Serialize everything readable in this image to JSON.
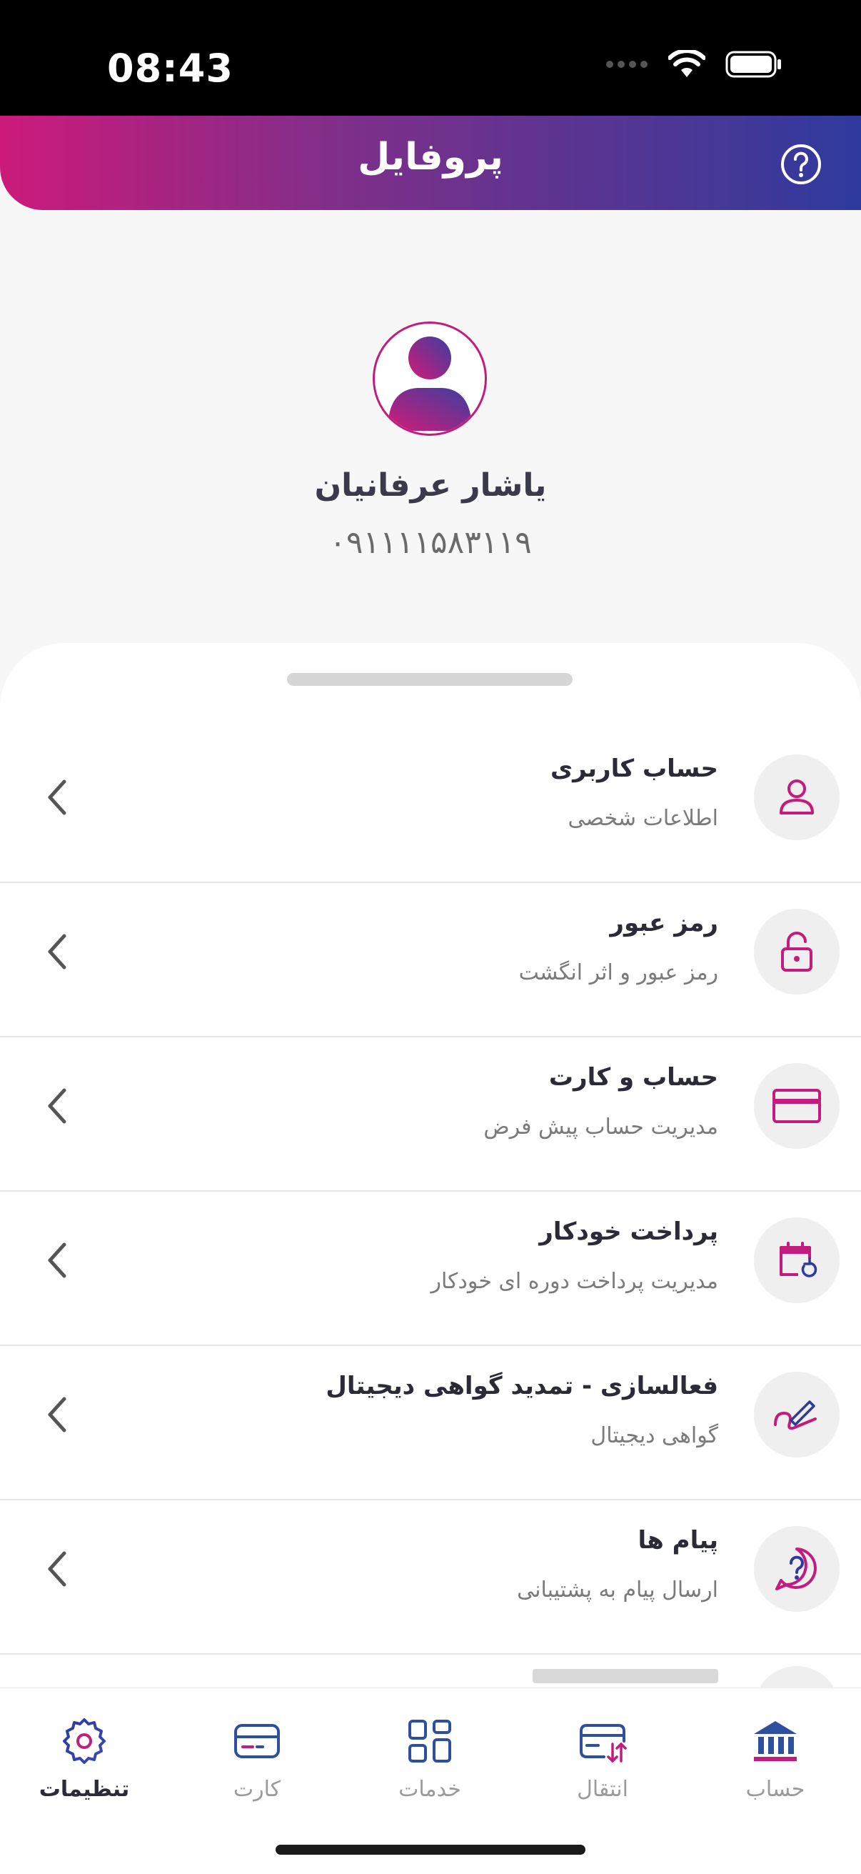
{
  "status_bar": {
    "time": "08:43"
  },
  "header": {
    "title": "پروفایل",
    "help_icon": "help-circle-icon"
  },
  "profile": {
    "name": "یاشار عرفانیان",
    "phone": "۰۹۱۱۱۱۵۸۳۱۱۹",
    "avatar_icon": "user-avatar-icon"
  },
  "menu": {
    "items": [
      {
        "title": "حساب کاربری",
        "subtitle": "اطلاعات شخصی",
        "icon": "user-icon"
      },
      {
        "title": "رمز عبور",
        "subtitle": "رمز عبور و اثر انگشت",
        "icon": "lock-open-icon"
      },
      {
        "title": "حساب و کارت",
        "subtitle": "مدیریت حساب پیش فرض",
        "icon": "credit-card-icon"
      },
      {
        "title": "پرداخت خودکار",
        "subtitle": "مدیریت پرداخت دوره ای خودکار",
        "icon": "calendar-refresh-icon"
      },
      {
        "title": "فعالسازی - تمدید گواهی دیجیتال",
        "subtitle": "گواهی دیجیتال",
        "icon": "signature-icon"
      },
      {
        "title": "پیام ها",
        "subtitle": "ارسال پیام به پشتیبانی",
        "icon": "chat-question-icon"
      }
    ]
  },
  "bottom_nav": {
    "items": [
      {
        "label": "تنظیمات",
        "icon": "gear-icon",
        "active": true
      },
      {
        "label": "کارت",
        "icon": "card-icon",
        "active": false
      },
      {
        "label": "خدمات",
        "icon": "grid-icon",
        "active": false
      },
      {
        "label": "انتقال",
        "icon": "transfer-icon",
        "active": false
      },
      {
        "label": "حساب",
        "icon": "bank-icon",
        "active": false
      }
    ]
  },
  "colors": {
    "accent_magenta": "#c21c7c",
    "accent_blue": "#2e3a9e",
    "text_dark": "#2b2b38",
    "text_muted": "#7a7a7a"
  }
}
